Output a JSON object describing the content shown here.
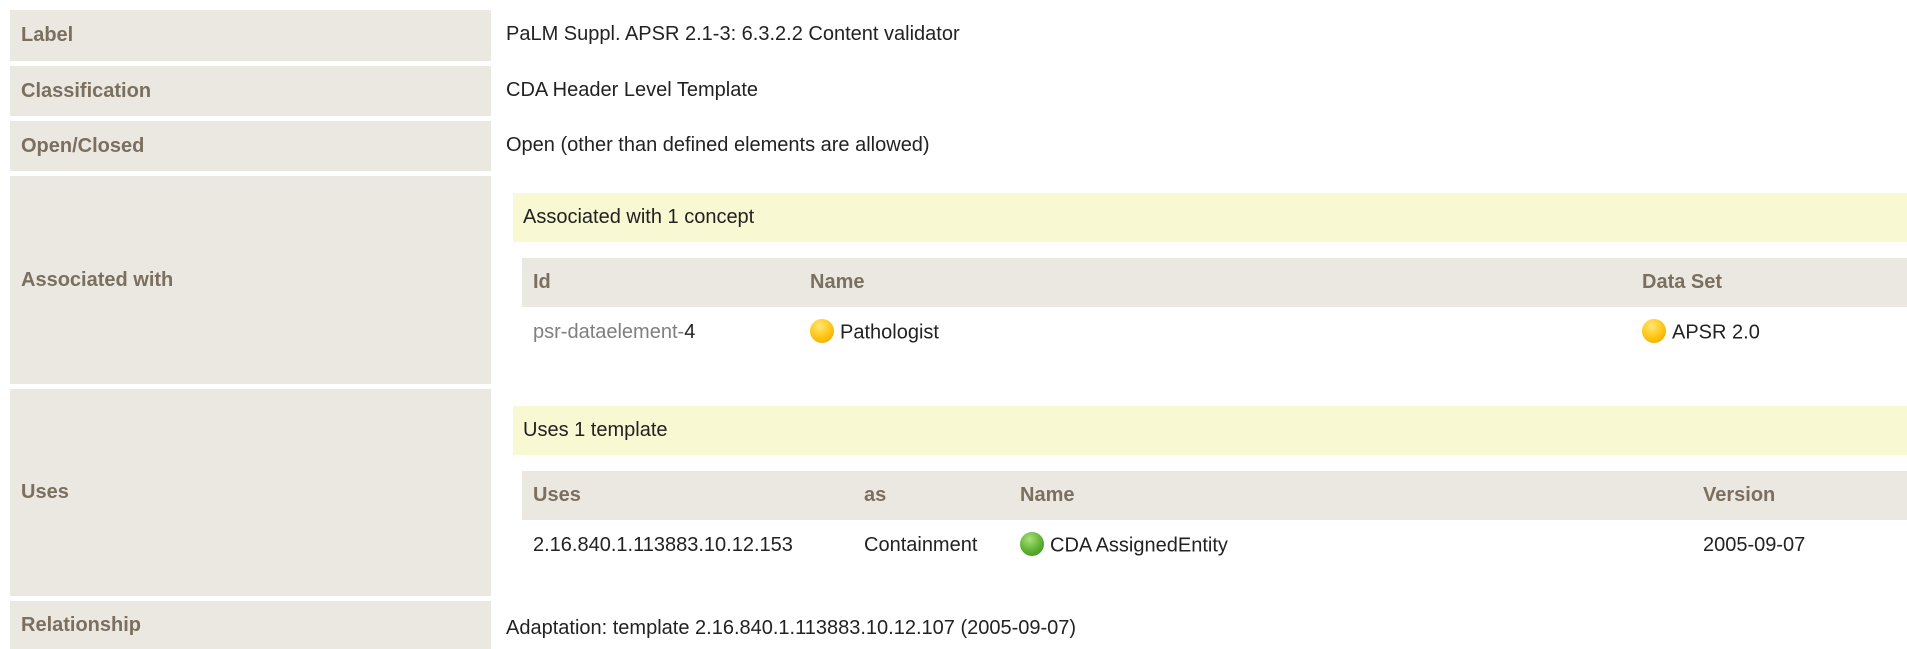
{
  "rows": {
    "label": {
      "label": "Label",
      "value": "PaLM Suppl. APSR 2.1-3: 6.3.2.2 Content validator"
    },
    "classification": {
      "label": "Classification",
      "value": "CDA Header Level Template"
    },
    "open_closed": {
      "label": "Open/Closed",
      "value": "Open (other than defined elements are allowed)"
    },
    "associated": {
      "label": "Associated with",
      "heading": "Associated with 1 concept",
      "columns": [
        "Id",
        "Name",
        "Data Set"
      ],
      "items": [
        {
          "id_prefix": "psr-dataelement-",
          "id_suffix": "4",
          "name": "Pathologist",
          "name_icon": "yellow-circle-icon",
          "dataset": "APSR 2.0",
          "dataset_icon": "yellow-circle-icon"
        }
      ]
    },
    "uses": {
      "label": "Uses",
      "heading": "Uses 1 template",
      "columns": [
        "Uses",
        "as",
        "Name",
        "Version"
      ],
      "items": [
        {
          "uses": "2.16.840.1.113883.10.12.153",
          "as": "Containment",
          "name": "CDA AssignedEntity",
          "name_icon": "green-circle-icon",
          "version": "2005-09-07"
        }
      ]
    },
    "relationship": {
      "label": "Relationship",
      "value": "Adaptation: template 2.16.840.1.113883.10.12.107 (2005-09-07)"
    }
  },
  "colors": {
    "label_bg": "#ebe8e2",
    "label_text": "#7b6f5f",
    "band_bg": "#f8f8d2",
    "status_yellow": "#ffc20e",
    "status_green": "#5cb030"
  }
}
